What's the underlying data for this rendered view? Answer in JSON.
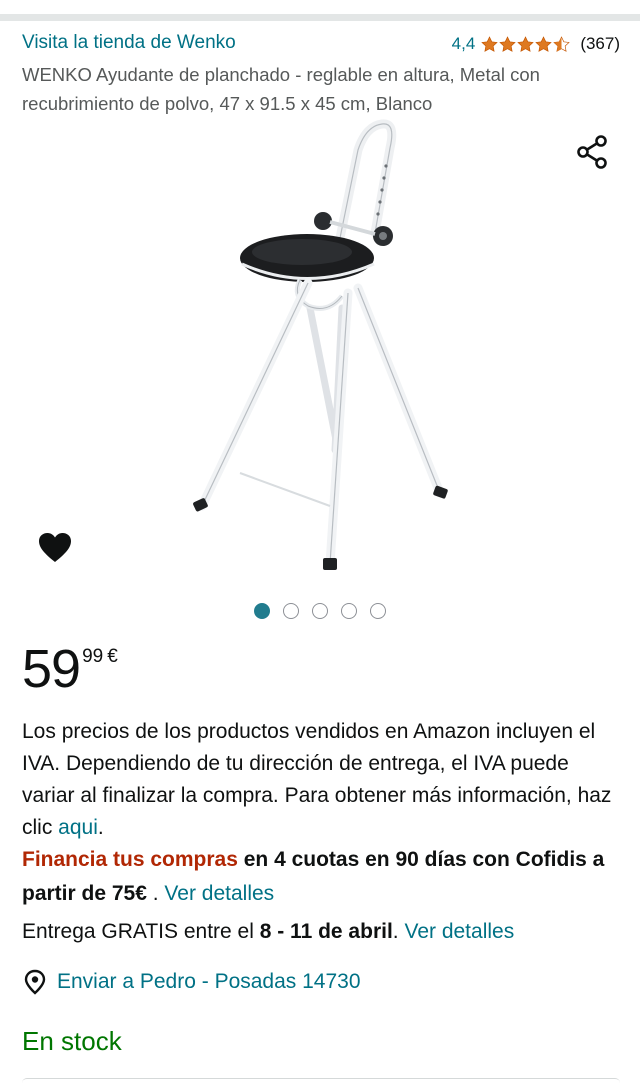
{
  "store": {
    "link_text": "Visita la tienda de Wenko",
    "rating": "4,4",
    "rating_count": "(367)",
    "stars_filled": 4.4
  },
  "product": {
    "title": "WENKO Ayudante de planchado - reglable en altura, Metal con recubrimiento de polvo, 47 x 91.5 x 45 cm, Blanco",
    "image_count": 5,
    "active_image": 1
  },
  "icons": {
    "share": "share-icon",
    "wishlist": "heart-icon",
    "location": "location-pin-icon",
    "star": "star-icon"
  },
  "price": {
    "whole": "59",
    "fraction": "99",
    "currency": "€"
  },
  "tax": {
    "text": "Los precios de los productos vendidos en Amazon incluyen el IVA. Dependiendo de tu dirección de entrega, el IVA puede variar al finalizar la compra. Para obtener más información, haz clic ",
    "link": "aqui",
    "end": "."
  },
  "finance": {
    "highlight": "Financia tus compras",
    "bold_text": " en 4 cuotas en 90 días con Cofidis a partir de 75€",
    "separator": " . ",
    "link": "Ver detalles"
  },
  "delivery": {
    "prefix": "Entrega GRATIS entre el ",
    "dates": "8 - 11 de abril",
    "suffix": ". ",
    "link": "Ver detalles"
  },
  "shipping": {
    "text": "Enviar a Pedro - Posadas 14730"
  },
  "availability": {
    "text": "En stock"
  },
  "colors": {
    "link": "#007185",
    "price_red": "#b12704",
    "in_stock": "#007600",
    "star": "#de7921",
    "active_dot": "#217c8e"
  }
}
